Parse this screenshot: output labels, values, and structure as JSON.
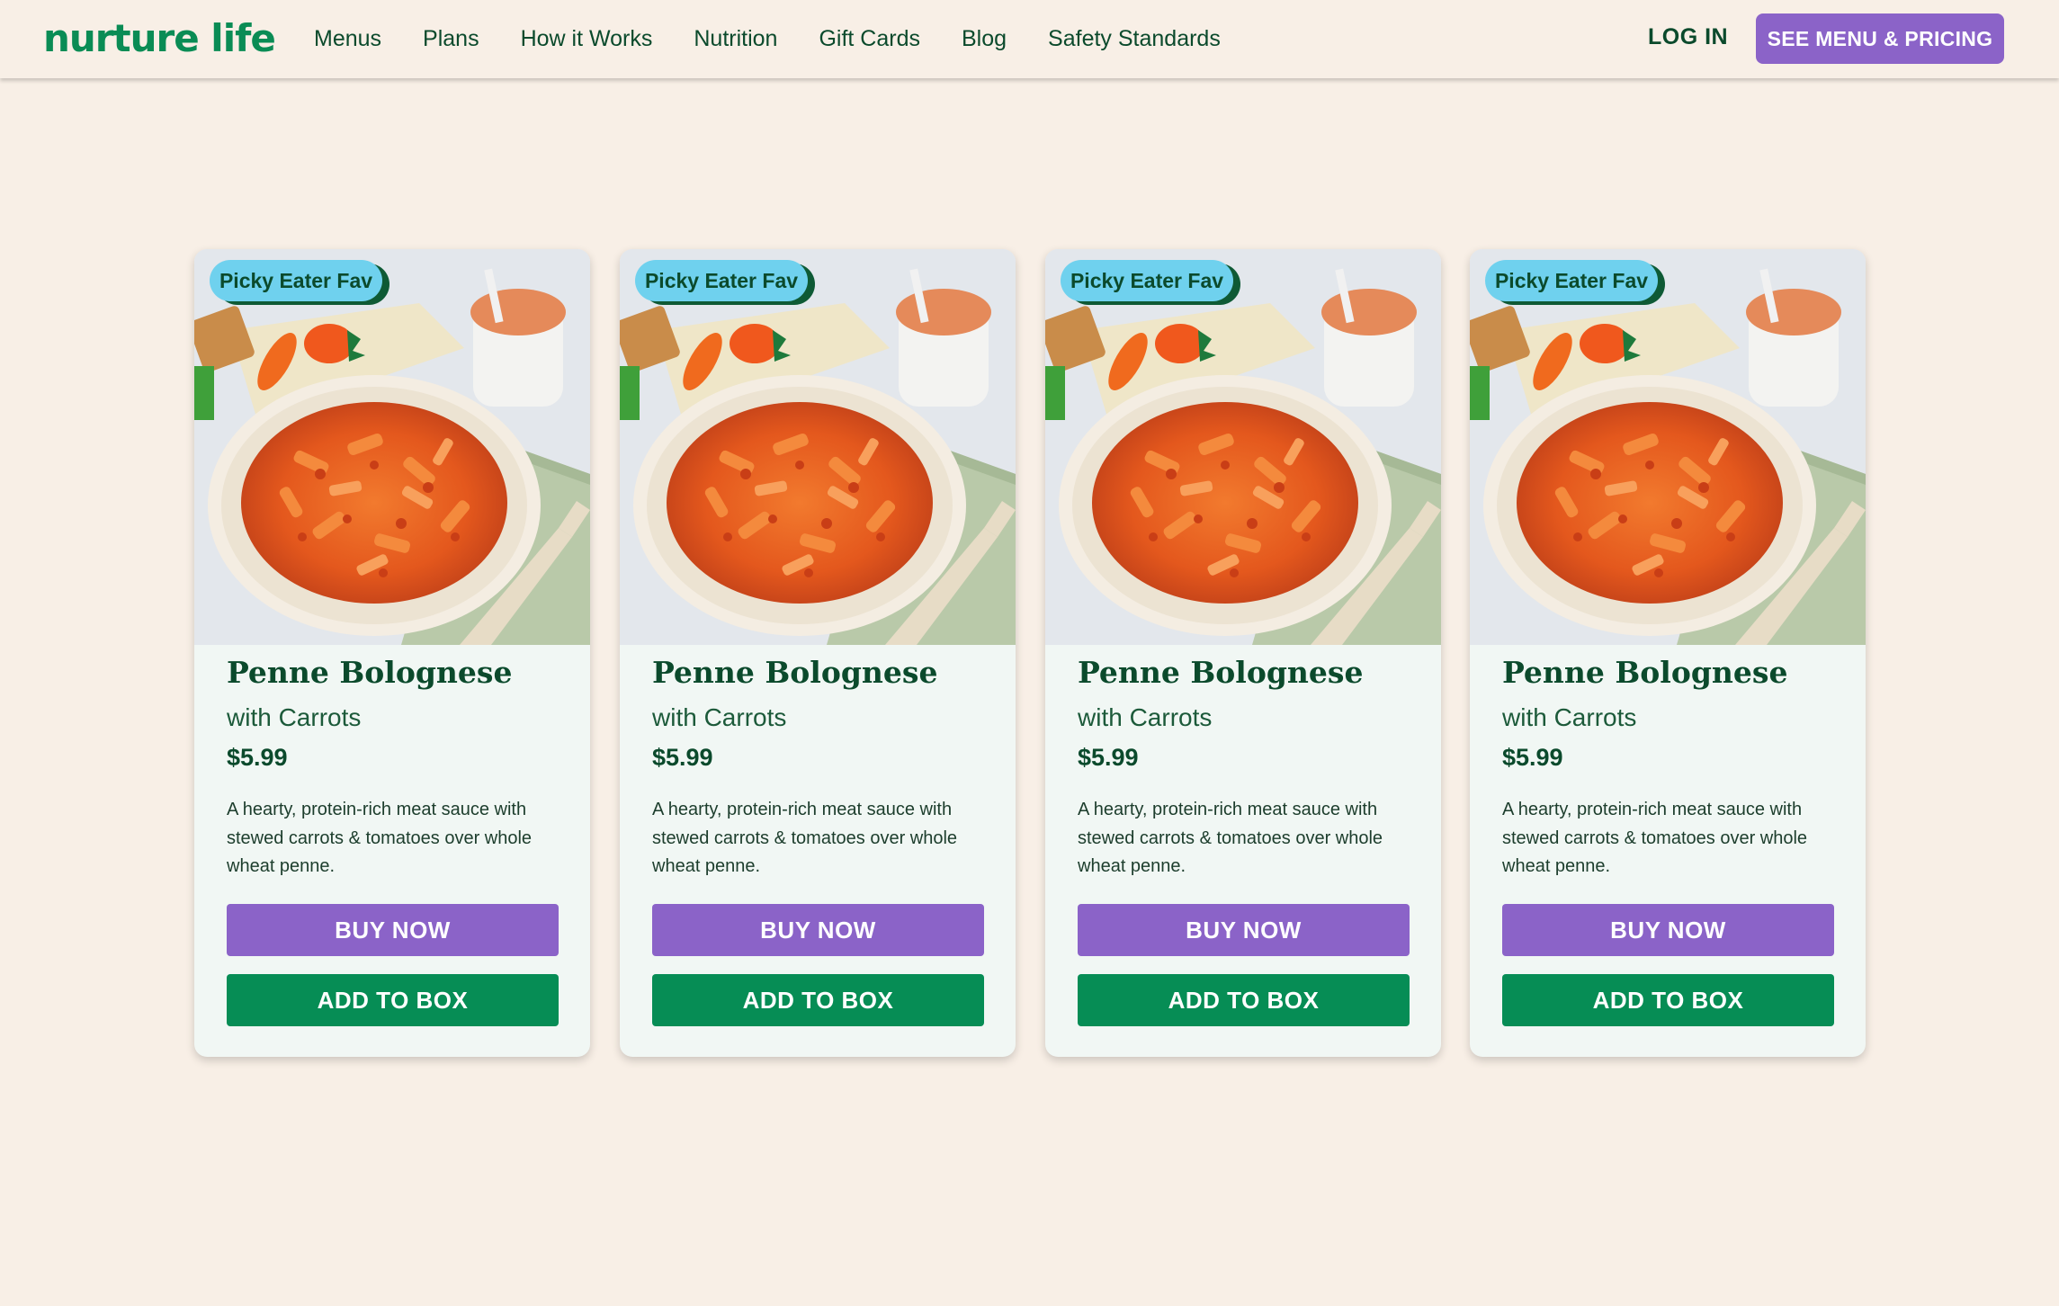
{
  "header": {
    "logo": "nurture life",
    "nav": [
      "Menus",
      "Plans",
      "How it Works",
      "Nutrition",
      "Gift Cards",
      "Blog",
      "Safety Standards"
    ],
    "login": "LOG IN",
    "cta": "SEE MENU & PRICING"
  },
  "cards": [
    {
      "badge": "Picky Eater Fav",
      "title": "Penne Bolognese",
      "subtitle": "with Carrots",
      "price": "$5.99",
      "description": "A hearty, protein-rich meat sauce with stewed carrots & tomatoes over whole wheat penne.",
      "buy_label": "BUY NOW",
      "add_label": "ADD TO BOX"
    },
    {
      "badge": "Picky Eater Fav",
      "title": "Penne Bolognese",
      "subtitle": "with Carrots",
      "price": "$5.99",
      "description": "A hearty, protein-rich meat sauce with stewed carrots & tomatoes over whole wheat penne.",
      "buy_label": "BUY NOW",
      "add_label": "ADD TO BOX"
    },
    {
      "badge": "Picky Eater Fav",
      "title": "Penne Bolognese",
      "subtitle": "with Carrots",
      "price": "$5.99",
      "description": "A hearty, protein-rich meat sauce with stewed carrots & tomatoes over whole wheat penne.",
      "buy_label": "BUY NOW",
      "add_label": "ADD TO BOX"
    },
    {
      "badge": "Picky Eater Fav",
      "title": "Penne Bolognese",
      "subtitle": "with Carrots",
      "price": "$5.99",
      "description": "A hearty, protein-rich meat sauce with stewed carrots & tomatoes over whole wheat penne.",
      "buy_label": "BUY NOW",
      "add_label": "ADD TO BOX"
    }
  ],
  "colors": {
    "background": "#f8efe6",
    "brand_green": "#0a8c55",
    "dark_green": "#0b4a2c",
    "purple": "#8b63c8",
    "badge_blue": "#6fd1ee",
    "card_bg": "#f1f7f4"
  }
}
